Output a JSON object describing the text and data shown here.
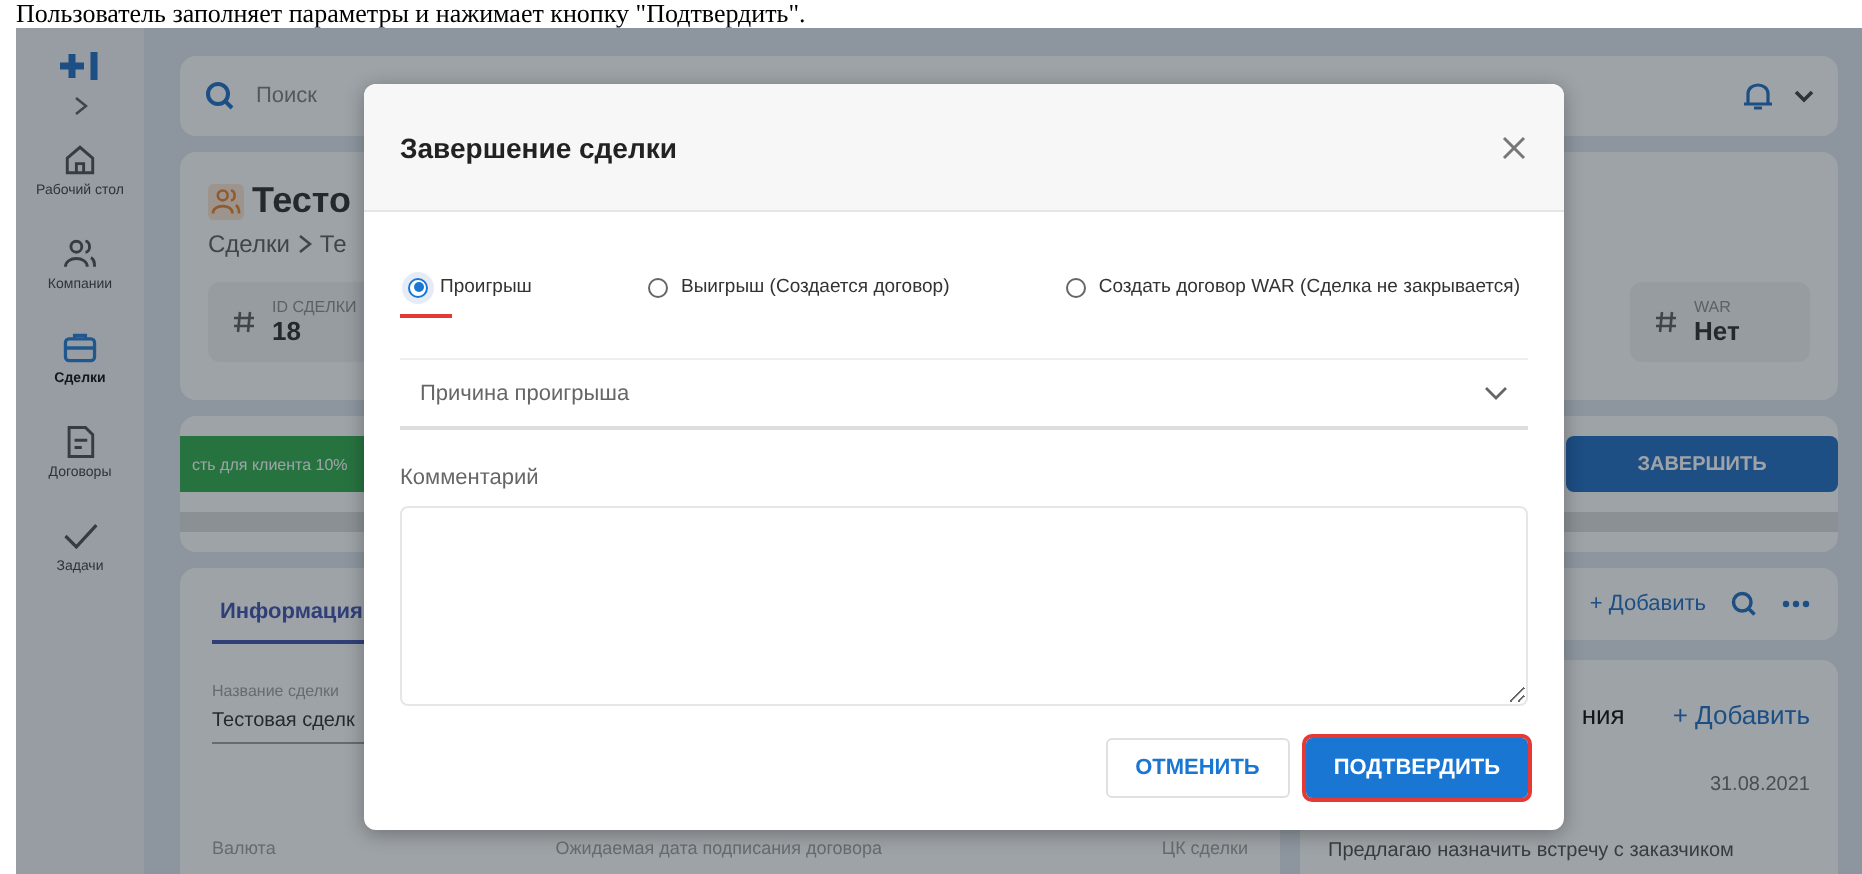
{
  "caption": "Пользователь заполняет параметры и нажимает кнопку \"Подтвердить\".",
  "sidebar": {
    "items": [
      {
        "label": "Рабочий стол",
        "selected": false
      },
      {
        "label": "Компании",
        "selected": false
      },
      {
        "label": "Сделки",
        "selected": true
      },
      {
        "label": "Договоры",
        "selected": false
      },
      {
        "label": "Задачи",
        "selected": false
      }
    ]
  },
  "topbar": {
    "search_placeholder": "Поиск"
  },
  "deal": {
    "title": "Тесто",
    "breadcrumb": [
      "Сделки",
      "Те"
    ],
    "stats": [
      {
        "label": "ID СДЕЛКИ",
        "value": "18"
      },
      {
        "label": "WAR",
        "value": "Нет"
      }
    ]
  },
  "stage": {
    "label": "сть для клиента 10%",
    "finish_button": "ЗАВЕРШИТЬ"
  },
  "info_card": {
    "tab": "Информация",
    "name_label": "Название сделки",
    "name_value": "Тестовая сделк",
    "currency_label": "Валюта",
    "date_label": "Ожидаемая дата подписания договора",
    "ck_label": "ЦК сделки"
  },
  "right_toolbar": {
    "add": "+ Добавить"
  },
  "notes_card": {
    "title": "ния",
    "add": "+ Добавить",
    "date": "31.08.2021",
    "text": "Предлагаю назначить встречу с заказчиком"
  },
  "modal": {
    "title": "Завершение сделки",
    "options": [
      {
        "label": "Проигрыш",
        "selected": true,
        "annotated": true
      },
      {
        "label": "Выигрыш (Создается договор)",
        "selected": false,
        "annotated": false
      },
      {
        "label": "Создать договор WAR (Сделка не закрывается)",
        "selected": false,
        "annotated": false
      }
    ],
    "reason": {
      "placeholder": "Причина проигрыша"
    },
    "comment": {
      "label": "Комментарий"
    },
    "buttons": [
      {
        "label": "ОТМЕНИТЬ",
        "kind": "secondary",
        "annotated": false
      },
      {
        "label": "ПОДТВЕРДИТЬ",
        "kind": "primary",
        "annotated": true
      }
    ]
  }
}
